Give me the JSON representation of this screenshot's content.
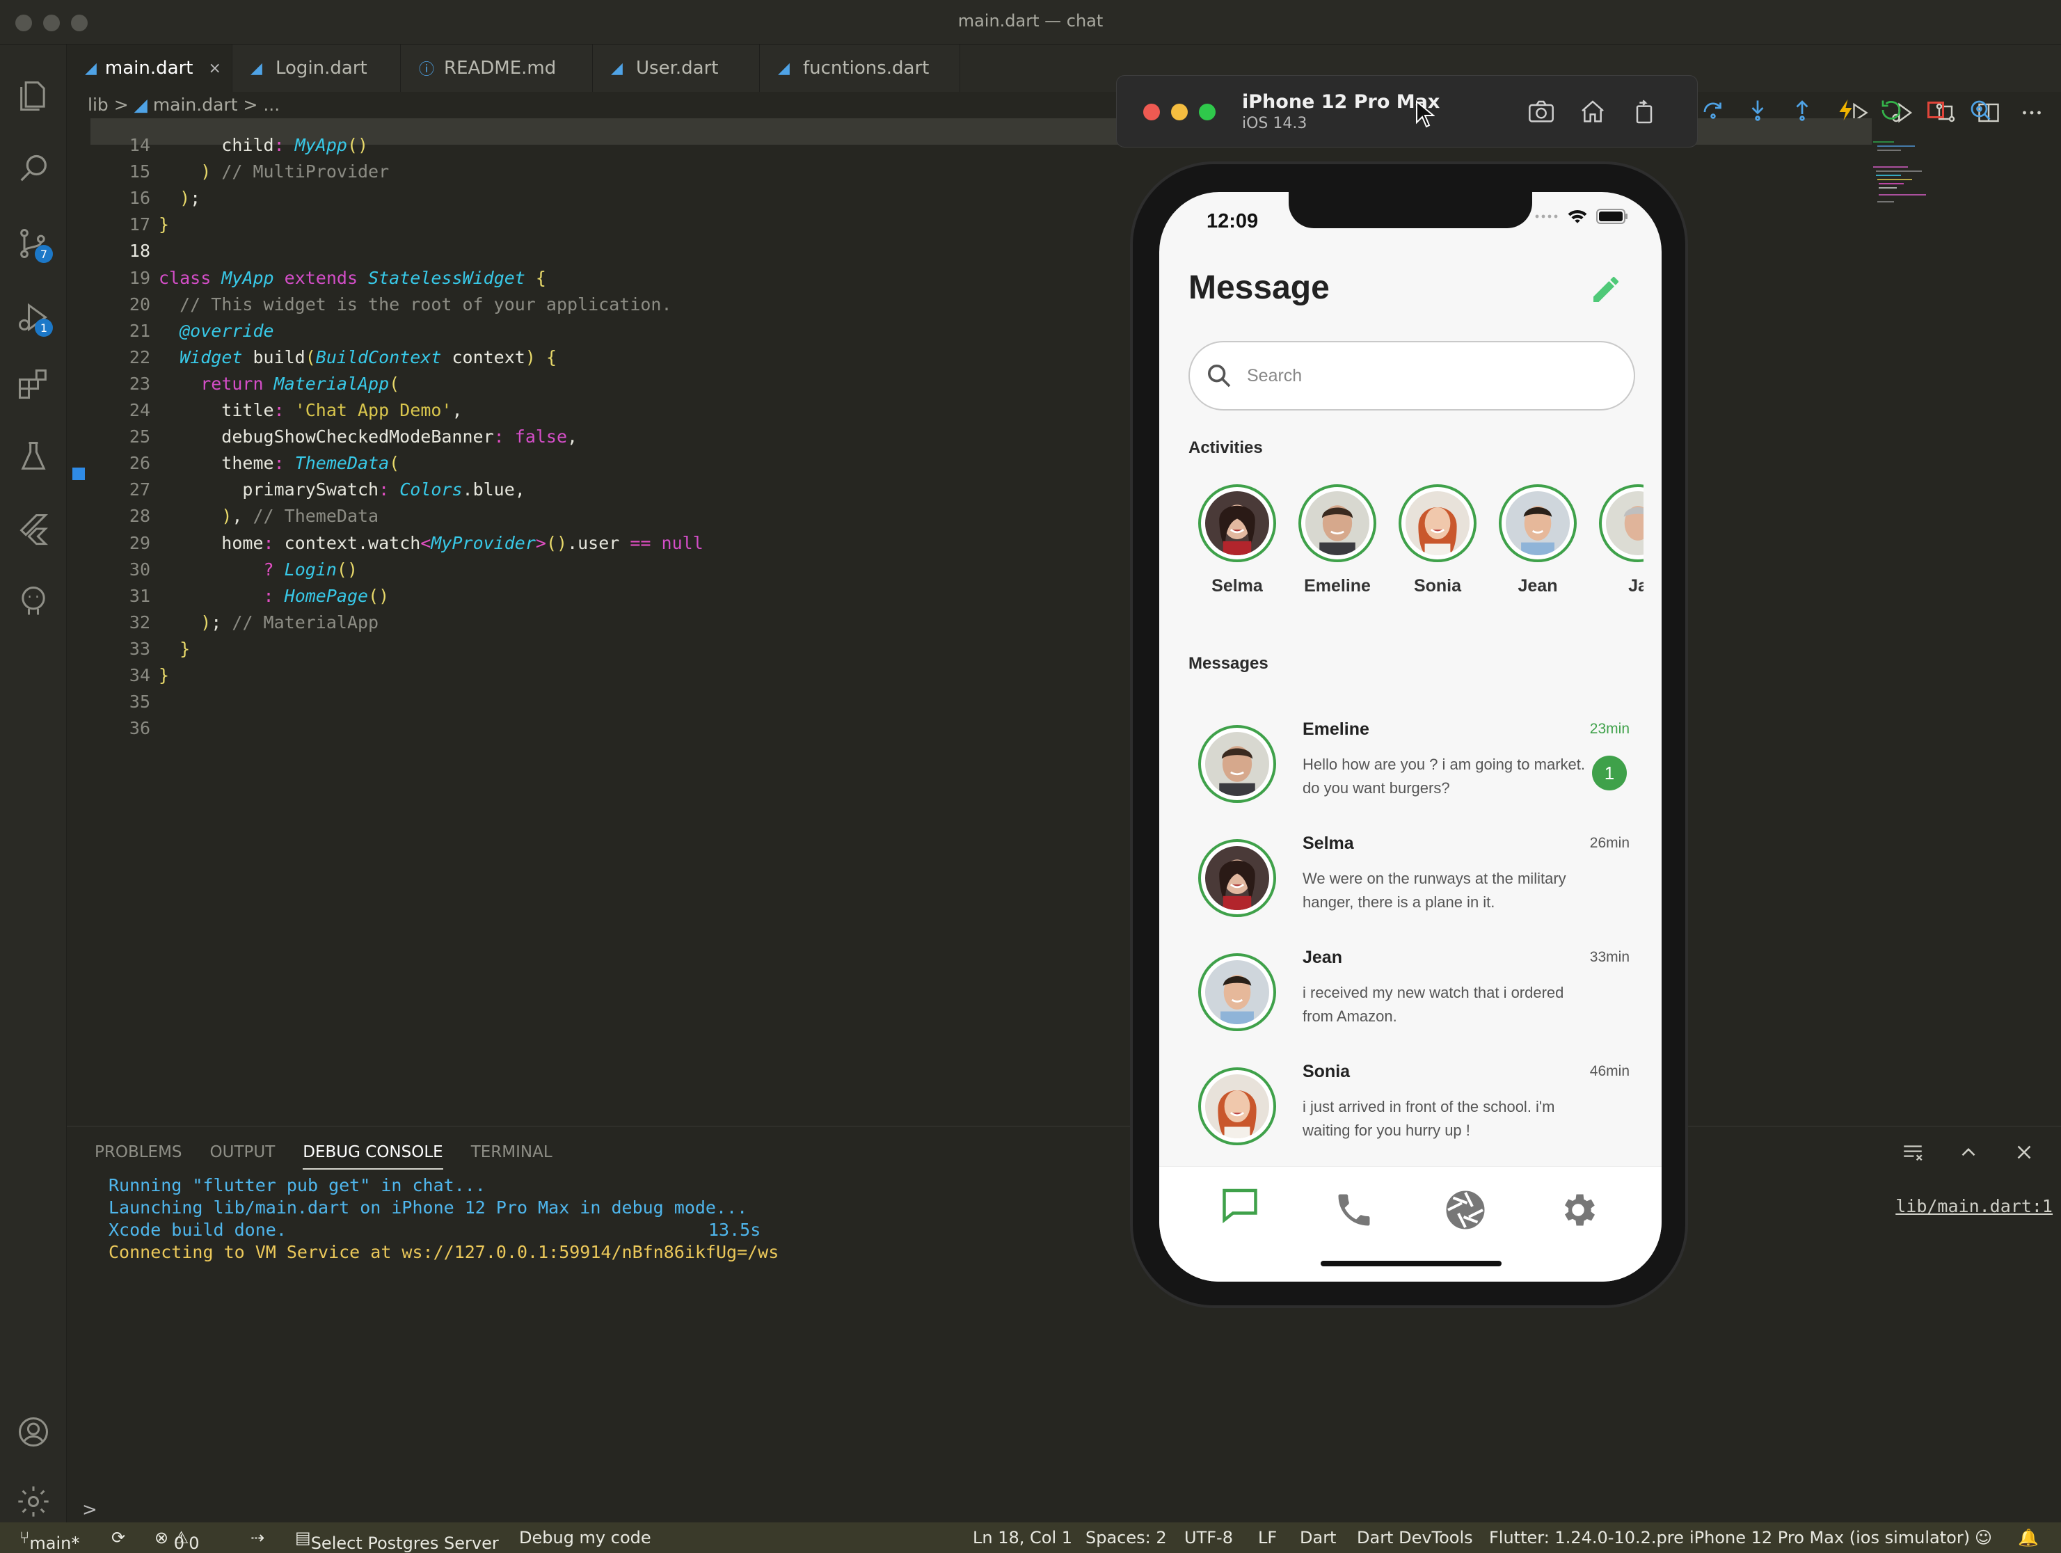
{
  "window": {
    "title": "main.dart — chat"
  },
  "tabs": [
    {
      "label": "main.dart",
      "close": "×"
    },
    {
      "label": "Login.dart"
    },
    {
      "label": "README.md"
    },
    {
      "label": "User.dart"
    },
    {
      "label": "fucntions.dart"
    }
  ],
  "breadcrumb": {
    "folder": "lib",
    "sep1": ">",
    "file": "main.dart",
    "sep2": ">",
    "rest": "..."
  },
  "activity": {
    "source_badge": "7",
    "debug_badge": "1"
  },
  "code": {
    "lines": [
      {
        "n": "14",
        "text": "      child: MyApp()"
      },
      {
        "n": "15",
        "text": "    ) // MultiProvider"
      },
      {
        "n": "16",
        "text": "  );"
      },
      {
        "n": "17",
        "text": "}"
      },
      {
        "n": "18",
        "text": ""
      },
      {
        "n": "19",
        "text": "class MyApp extends StatelessWidget {"
      },
      {
        "n": "20",
        "text": "  // This widget is the root of your application."
      },
      {
        "n": "21",
        "text": "  @override"
      },
      {
        "n": "22",
        "text": "  Widget build(BuildContext context) {"
      },
      {
        "n": "23",
        "text": "    return MaterialApp("
      },
      {
        "n": "24",
        "text": "      title: 'Chat App Demo',"
      },
      {
        "n": "25",
        "text": "      debugShowCheckedModeBanner: false,"
      },
      {
        "n": "26",
        "text": "      theme: ThemeData("
      },
      {
        "n": "27",
        "text": "        primarySwatch: Colors.blue,"
      },
      {
        "n": "28",
        "text": "      ), // ThemeData"
      },
      {
        "n": "29",
        "text": "      home: context.watch<MyProvider>().user == null"
      },
      {
        "n": "30",
        "text": "          ? Login()"
      },
      {
        "n": "31",
        "text": "          : HomePage()"
      },
      {
        "n": "32",
        "text": "    ); // MaterialApp"
      },
      {
        "n": "33",
        "text": "  }"
      },
      {
        "n": "34",
        "text": "}"
      },
      {
        "n": "35",
        "text": ""
      },
      {
        "n": "36",
        "text": ""
      }
    ]
  },
  "panel": {
    "tabs": [
      "PROBLEMS",
      "OUTPUT",
      "DEBUG CONSOLE",
      "TERMINAL"
    ],
    "active": "DEBUG CONSOLE",
    "console": [
      "Running \"flutter pub get\" in chat...",
      "Launching lib/main.dart on iPhone 12 Pro Max in debug mode...",
      "Xcode build done.",
      "Connecting to VM Service at ws://127.0.0.1:59914/nBfn86ikfUg=/ws"
    ],
    "build_time": "13.5s",
    "link": "lib/main.dart:1",
    "prompt": ">"
  },
  "status": {
    "branch": "main*",
    "errors": "0",
    "warnings": "0",
    "postgres": "Select Postgres Server",
    "debug": "Debug my code",
    "position": "Ln 18, Col 1",
    "spaces": "Spaces: 2",
    "encoding": "UTF-8",
    "eol": "LF",
    "lang": "Dart",
    "devtools": "Dart DevTools",
    "flutter": "Flutter: 1.24.0-10.2.pre",
    "device": "iPhone 12 Pro Max (ios simulator)"
  },
  "simulator": {
    "name": "iPhone 12 Pro Max",
    "os": "iOS 14.3"
  },
  "app": {
    "time": "12:09",
    "title": "Message",
    "search_placeholder": "Search",
    "activities_label": "Activities",
    "messages_label": "Messages",
    "activities": [
      "Selma",
      "Emeline",
      "Sonia",
      "Jean",
      "Ja"
    ],
    "messages": [
      {
        "name": "Emeline",
        "text": "Hello how are you ? i am going to market. do you want burgers?",
        "time": "23min",
        "unread": "1"
      },
      {
        "name": "Selma",
        "text": "We were on the runways at the military hanger, there is a plane in it.",
        "time": "26min"
      },
      {
        "name": "Jean",
        "text": "i received my new watch that i ordered from Amazon.",
        "time": "33min"
      },
      {
        "name": "Sonia",
        "text": "i just arrived in front of the school. i'm waiting for you hurry up !",
        "time": "46min"
      }
    ]
  },
  "colors": {
    "accent_green": "#3fa14a",
    "editor_bg": "#262621",
    "status_bg": "#3a3a2a",
    "link_blue": "#4fb6ec",
    "console_yellow": "#ebc85a"
  }
}
